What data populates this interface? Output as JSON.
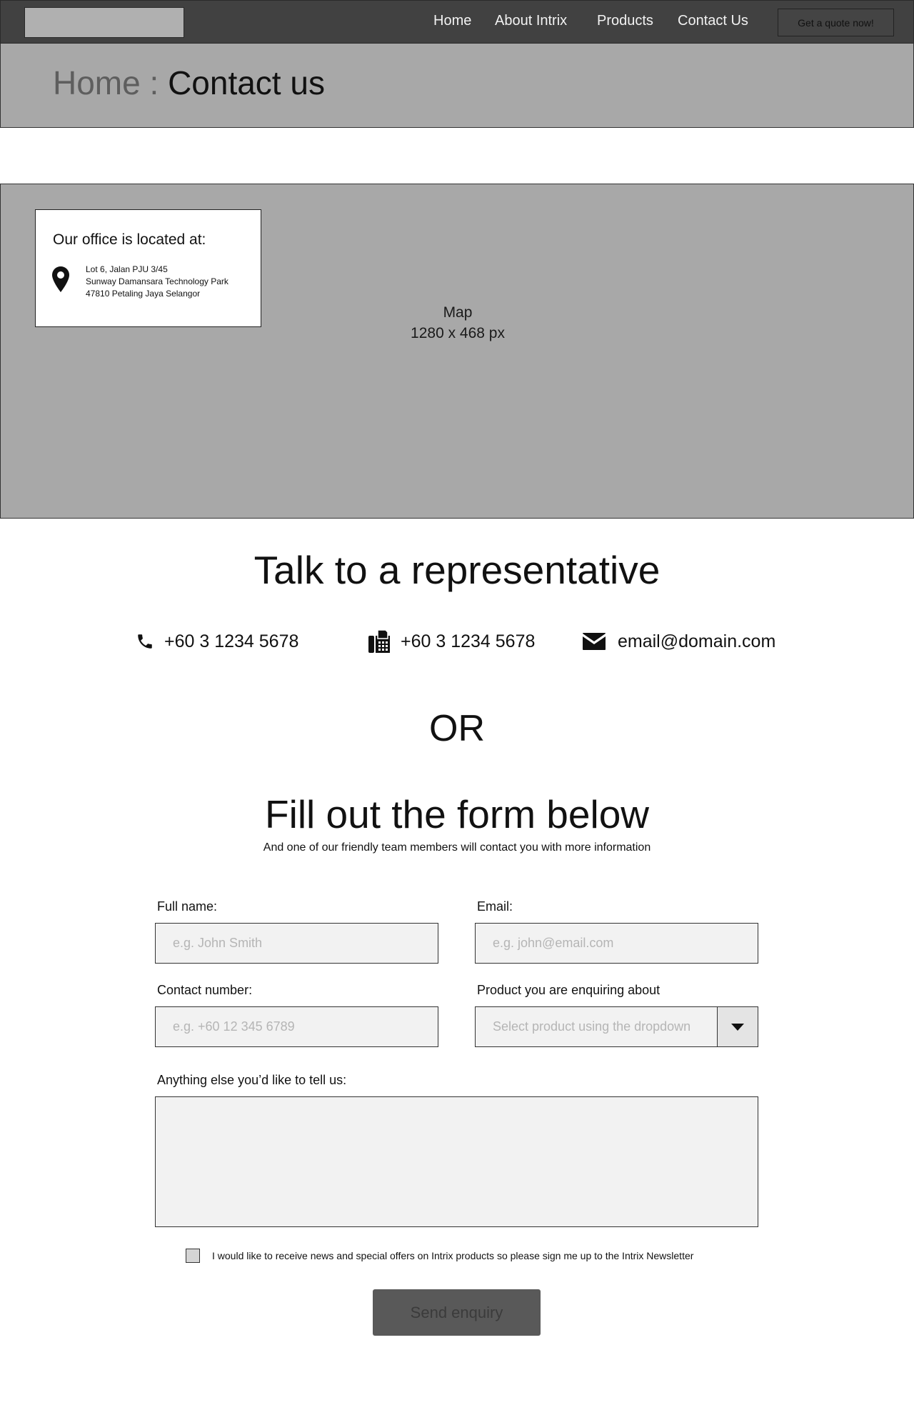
{
  "nav": {
    "links": [
      "Home",
      "About Intrix",
      "Products",
      "Contact Us"
    ],
    "quote_button": "Get a quote now!"
  },
  "breadcrumb": {
    "home": "Home",
    "separator": " : ",
    "current": "Contact us"
  },
  "map": {
    "label": "Map",
    "size_label": "1280 x 468 px",
    "office": {
      "title": "Our office is located at:",
      "address": [
        "Lot 6, Jalan PJU 3/45",
        "Sunway Damansara Technology Park",
        "47810 Petaling Jaya Selangor"
      ]
    }
  },
  "talk": {
    "heading": "Talk to a representative",
    "phone": "+60 3 1234 5678",
    "fax": "+60 3 1234 5678",
    "email": "email@domain.com"
  },
  "or_text": "OR",
  "form": {
    "heading": "Fill out the form below",
    "subtext": "And one of our friendly team members will contact you with more information",
    "full_name": {
      "label": "Full name:",
      "placeholder": "e.g. John Smith"
    },
    "email": {
      "label": "Email:",
      "placeholder": "e.g. john@email.com"
    },
    "contact": {
      "label": "Contact number:",
      "placeholder": "e.g. +60 12 345 6789"
    },
    "product": {
      "label": "Product you are enquiring about",
      "placeholder": "Select product using the dropdown"
    },
    "message": {
      "label": "Anything else you’d like to tell us:"
    },
    "newsletter": "I would like to receive news and special offers on Intrix products so please sign me up to the Intrix Newsletter",
    "submit": "Send enquiry"
  }
}
